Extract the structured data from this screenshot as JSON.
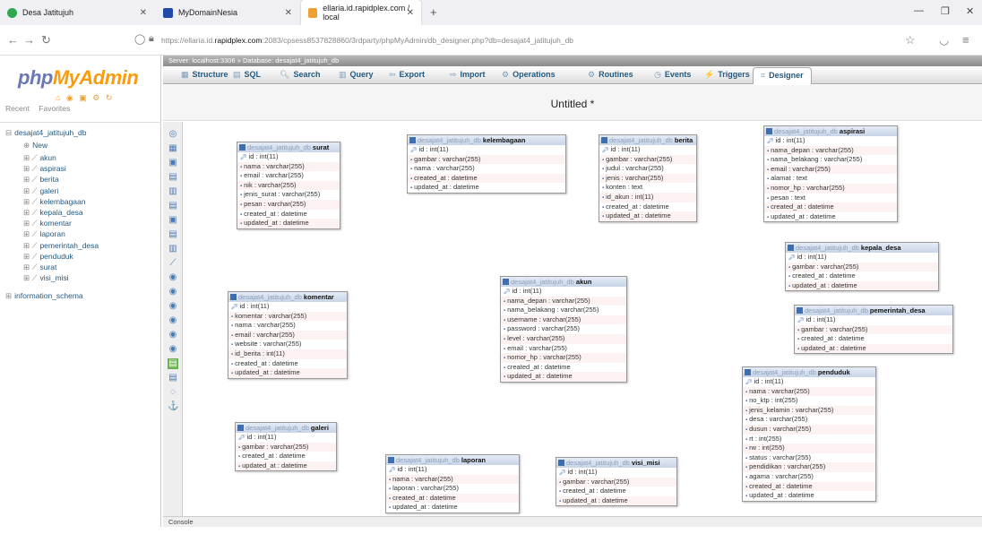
{
  "browser": {
    "tabs": [
      {
        "title": "Desa Jatitujuh",
        "color": "#2fa84f"
      },
      {
        "title": "MyDomainNesia",
        "color": "#1f4aa8"
      },
      {
        "title": "ellaria.id.rapidplex.com / local",
        "color": "#f0a030"
      }
    ],
    "url_prefix": "https://ellaria.id.",
    "url_domain": "rapidplex.com",
    "url_rest": ":2083/cpsess8537828860/3rdparty/phpMyAdmin/db_designer.php?db=desajat4_jatitujuh_db"
  },
  "pma": {
    "logo_a": "php",
    "logo_b": "MyAdmin",
    "recent": "Recent",
    "favorites": "Favorites",
    "breadcrumb": "Server: localhost:3306 » Database: desajat4_jatitujuh_db",
    "tree": {
      "db": "desajat4_jatitujuh_db",
      "new": "New",
      "tables": [
        "akun",
        "aspirasi",
        "berita",
        "galeri",
        "kelembagaan",
        "kepala_desa",
        "komentar",
        "laporan",
        "pemerintah_desa",
        "penduduk",
        "surat",
        "visi_misi"
      ],
      "schema": "information_schema"
    },
    "menu": [
      "Structure",
      "SQL",
      "Search",
      "Query",
      "Export",
      "Import",
      "Operations",
      "Routines",
      "Events",
      "Triggers",
      "Designer"
    ],
    "designer_title": "Untitled *",
    "console": "Console",
    "db_prefix": "desajat4_jatitujuh_db"
  },
  "tables": [
    {
      "name": "surat",
      "cols": [
        [
          "id",
          "int(11)"
        ],
        [
          "nama",
          "varchar(255)"
        ],
        [
          "email",
          "varchar(255)"
        ],
        [
          "nik",
          "varchar(255)"
        ],
        [
          "jenis_surat",
          "varchar(255)"
        ],
        [
          "pesan",
          "varchar(255)"
        ],
        [
          "created_at",
          "datetime"
        ],
        [
          "updated_at",
          "datetime"
        ]
      ]
    },
    {
      "name": "kelembagaan",
      "cols": [
        [
          "id",
          "int(11)"
        ],
        [
          "gambar",
          "varchar(255)"
        ],
        [
          "nama",
          "varchar(255)"
        ],
        [
          "created_at",
          "datetime"
        ],
        [
          "updated_at",
          "datetime"
        ]
      ]
    },
    {
      "name": "berita",
      "cols": [
        [
          "id",
          "int(11)"
        ],
        [
          "gambar",
          "varchar(255)"
        ],
        [
          "judul",
          "varchar(255)"
        ],
        [
          "jenis",
          "varchar(255)"
        ],
        [
          "konten",
          "text"
        ],
        [
          "id_akun",
          "int(11)"
        ],
        [
          "created_at",
          "datetime"
        ],
        [
          "updated_at",
          "datetime"
        ]
      ]
    },
    {
      "name": "aspirasi",
      "cols": [
        [
          "id",
          "int(11)"
        ],
        [
          "nama_depan",
          "varchar(255)"
        ],
        [
          "nama_belakang",
          "varchar(255)"
        ],
        [
          "email",
          "varchar(255)"
        ],
        [
          "alamat",
          "text"
        ],
        [
          "nomor_hp",
          "varchar(255)"
        ],
        [
          "pesan",
          "text"
        ],
        [
          "created_at",
          "datetime"
        ],
        [
          "updated_at",
          "datetime"
        ]
      ]
    },
    {
      "name": "kepala_desa",
      "cols": [
        [
          "id",
          "int(11)"
        ],
        [
          "gambar",
          "varchar(255)"
        ],
        [
          "created_at",
          "datetime"
        ],
        [
          "updated_at",
          "datetime"
        ]
      ]
    },
    {
      "name": "pemerintah_desa",
      "cols": [
        [
          "id",
          "int(11)"
        ],
        [
          "gambar",
          "varchar(255)"
        ],
        [
          "created_at",
          "datetime"
        ],
        [
          "updated_at",
          "datetime"
        ]
      ]
    },
    {
      "name": "komentar",
      "cols": [
        [
          "id",
          "int(11)"
        ],
        [
          "komentar",
          "varchar(255)"
        ],
        [
          "nama",
          "varchar(255)"
        ],
        [
          "email",
          "varchar(255)"
        ],
        [
          "website",
          "varchar(255)"
        ],
        [
          "id_berita",
          "int(11)"
        ],
        [
          "created_at",
          "datetime"
        ],
        [
          "updated_at",
          "datetime"
        ]
      ]
    },
    {
      "name": "akun",
      "cols": [
        [
          "id",
          "int(11)"
        ],
        [
          "nama_depan",
          "varchar(255)"
        ],
        [
          "nama_belakang",
          "varchar(255)"
        ],
        [
          "username",
          "varchar(255)"
        ],
        [
          "password",
          "varchar(255)"
        ],
        [
          "level",
          "varchar(255)"
        ],
        [
          "email",
          "varchar(255)"
        ],
        [
          "nomor_hp",
          "varchar(255)"
        ],
        [
          "created_at",
          "datetime"
        ],
        [
          "updated_at",
          "datetime"
        ]
      ]
    },
    {
      "name": "penduduk",
      "cols": [
        [
          "id",
          "int(11)"
        ],
        [
          "nama",
          "varchar(255)"
        ],
        [
          "no_ktp",
          "int(255)"
        ],
        [
          "jenis_kelamin",
          "varchar(255)"
        ],
        [
          "desa",
          "varchar(255)"
        ],
        [
          "dusun",
          "varchar(255)"
        ],
        [
          "rt",
          "int(255)"
        ],
        [
          "rw",
          "int(255)"
        ],
        [
          "status",
          "varchar(255)"
        ],
        [
          "pendidikan",
          "varchar(255)"
        ],
        [
          "agama",
          "varchar(255)"
        ],
        [
          "created_at",
          "datetime"
        ],
        [
          "updated_at",
          "datetime"
        ]
      ]
    },
    {
      "name": "galeri",
      "cols": [
        [
          "id",
          "int(11)"
        ],
        [
          "gambar",
          "varchar(255)"
        ],
        [
          "created_at",
          "datetime"
        ],
        [
          "updated_at",
          "datetime"
        ]
      ]
    },
    {
      "name": "laporan",
      "cols": [
        [
          "id",
          "int(11)"
        ],
        [
          "nama",
          "varchar(255)"
        ],
        [
          "laporan",
          "varchar(255)"
        ],
        [
          "created_at",
          "datetime"
        ],
        [
          "updated_at",
          "datetime"
        ]
      ]
    },
    {
      "name": "visi_misi",
      "cols": [
        [
          "id",
          "int(11)"
        ],
        [
          "gambar",
          "varchar(255)"
        ],
        [
          "created_at",
          "datetime"
        ],
        [
          "updated_at",
          "datetime"
        ]
      ]
    }
  ]
}
